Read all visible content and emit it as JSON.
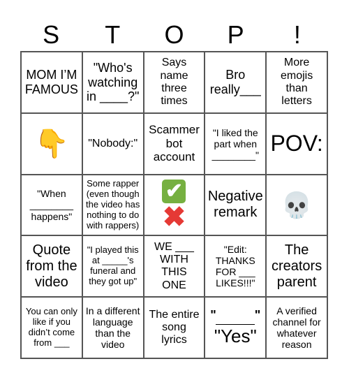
{
  "title_letters": [
    "S",
    "T",
    "O",
    "P",
    "!"
  ],
  "cells": [
    {
      "text": "MOM I’M\nFAMOUS"
    },
    {
      "text": "\"Who's\nwatching\nin ____?\""
    },
    {
      "text": "Says\nname\nthree\ntimes"
    },
    {
      "text": "Bro\nreally___"
    },
    {
      "text": "More\nemojis\nthan\nletters"
    },
    {
      "text": "👇",
      "icon": "backhand-index-pointing-down-icon"
    },
    {
      "text": "\"Nobody:\""
    },
    {
      "text": "Scammer\nbot\naccount"
    },
    {
      "text": "\"I liked the\npart when\n________\""
    },
    {
      "text": "POV:"
    },
    {
      "text": "\"When\n________\nhappens\""
    },
    {
      "text": "Some rapper\n(even though\nthe video has\nnothing to do\nwith rappers)"
    },
    {
      "check": "✔",
      "cross": "✖",
      "icon": "check-cross-icon"
    },
    {
      "text": "Negative\nremark"
    },
    {
      "text": "💀",
      "icon": "skull-icon"
    },
    {
      "text": "Quote\nfrom the\nvideo"
    },
    {
      "text": "\"I played this\nat _____'s\nfuneral and\nthey got up\""
    },
    {
      "text": "WE ___\nWITH\nTHIS\nONE"
    },
    {
      "text": "\"Edit:\nTHANKS\nFOR ___\nLIKES!!!\""
    },
    {
      "text": "The\ncreators\nparent"
    },
    {
      "text": "You can only\nlike if you\ndidn’t come\nfrom ___"
    },
    {
      "text": "In a different\nlanguage\nthan the\nvideo"
    },
    {
      "text": "The entire\nsong\nlyrics"
    },
    {
      "open_quote": "\"",
      "close_quote": "\"",
      "yes": "\"Yes\""
    },
    {
      "text": "A verified\nchannel for\nwhatever\nreason"
    }
  ]
}
